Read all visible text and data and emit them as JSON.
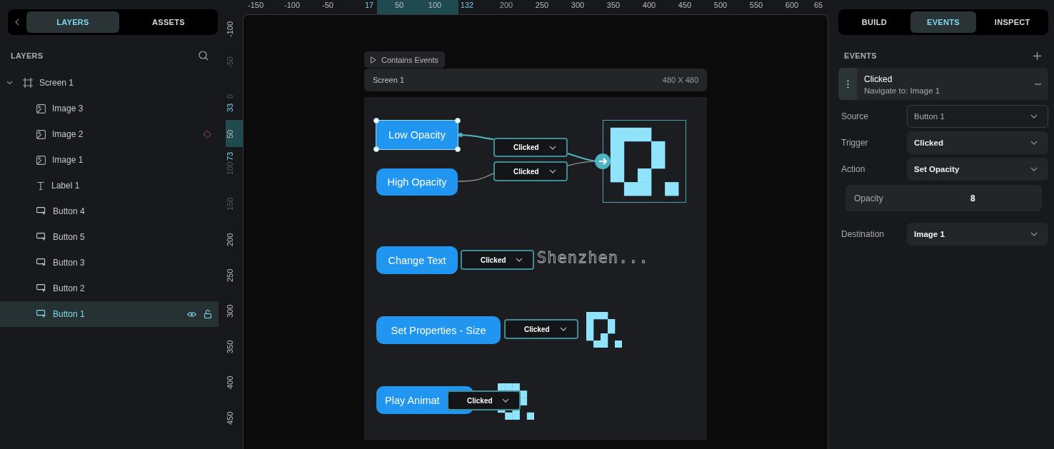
{
  "left_panel": {
    "tabs": [
      {
        "label": "LAYERS",
        "selected": true
      },
      {
        "label": "ASSETS",
        "selected": false
      }
    ],
    "section_title": "LAYERS",
    "layers": [
      {
        "name": "Screen 1",
        "kind": "screen",
        "expanded": true,
        "selected": false,
        "children": [
          {
            "name": "Image 3",
            "kind": "image",
            "selected": false,
            "flagged": false
          },
          {
            "name": "Image 2",
            "kind": "image",
            "selected": false,
            "flagged": true
          },
          {
            "name": "Image 1",
            "kind": "image",
            "selected": false,
            "flagged": false
          },
          {
            "name": "Label 1",
            "kind": "label",
            "selected": false,
            "flagged": false
          },
          {
            "name": "Button 4",
            "kind": "button",
            "selected": false,
            "flagged": false
          },
          {
            "name": "Button 5",
            "kind": "button",
            "selected": false,
            "flagged": false
          },
          {
            "name": "Button 3",
            "kind": "button",
            "selected": false,
            "flagged": false
          },
          {
            "name": "Button 2",
            "kind": "button",
            "selected": false,
            "flagged": false
          },
          {
            "name": "Button 1",
            "kind": "button",
            "selected": true,
            "flagged": false
          }
        ]
      }
    ]
  },
  "rulers": {
    "horizontal": [
      {
        "label": "-150",
        "kind": "tick"
      },
      {
        "label": "-100",
        "kind": "tick"
      },
      {
        "label": "-50",
        "kind": "tick"
      },
      {
        "label": "17",
        "kind": "marker"
      },
      {
        "label": "50",
        "kind": "tick"
      },
      {
        "label": "100",
        "kind": "tick"
      },
      {
        "label": "132",
        "kind": "marker"
      },
      {
        "label": "200",
        "kind": "dim"
      },
      {
        "label": "250",
        "kind": "tick"
      },
      {
        "label": "300",
        "kind": "tick"
      },
      {
        "label": "350",
        "kind": "tick"
      },
      {
        "label": "400",
        "kind": "tick"
      },
      {
        "label": "450",
        "kind": "tick"
      },
      {
        "label": "500",
        "kind": "tick"
      },
      {
        "label": "550",
        "kind": "tick"
      },
      {
        "label": "600",
        "kind": "tick"
      },
      {
        "label": "65",
        "kind": "tick"
      }
    ],
    "vertical": [
      {
        "label": "-100",
        "kind": "tick"
      },
      {
        "label": "-50",
        "kind": "dim"
      },
      {
        "label": "0",
        "kind": "dim"
      },
      {
        "label": "33",
        "kind": "marker"
      },
      {
        "label": "50",
        "kind": "tick"
      },
      {
        "label": "73",
        "kind": "marker"
      },
      {
        "label": "100",
        "kind": "dim"
      },
      {
        "label": "150",
        "kind": "dim"
      },
      {
        "label": "200",
        "kind": "tick"
      },
      {
        "label": "250",
        "kind": "tick"
      },
      {
        "label": "300",
        "kind": "tick"
      },
      {
        "label": "350",
        "kind": "tick"
      },
      {
        "label": "400",
        "kind": "tick"
      },
      {
        "label": "450",
        "kind": "tick"
      }
    ]
  },
  "canvas": {
    "badge": "Contains Events",
    "screen": {
      "title": "Screen 1",
      "size": "480 X 480"
    },
    "elements": [
      {
        "kind": "button",
        "label": "Low Opacity",
        "selected": true
      },
      {
        "kind": "trigger",
        "label": "Clicked"
      },
      {
        "kind": "trigger",
        "label": "Clicked"
      },
      {
        "kind": "button",
        "label": "High Opacity",
        "selected": false
      },
      {
        "kind": "image",
        "targeted": true
      },
      {
        "kind": "button",
        "label": "Change Text",
        "selected": false
      },
      {
        "kind": "trigger",
        "label": "Clicked"
      },
      {
        "kind": "text",
        "label": "Shenzhen..."
      },
      {
        "kind": "button",
        "label": "Set Properties - Size",
        "selected": false
      },
      {
        "kind": "trigger",
        "label": "Clicked"
      },
      {
        "kind": "image",
        "targeted": false
      },
      {
        "kind": "button",
        "label": "Play Animat",
        "selected": false
      },
      {
        "kind": "image",
        "targeted": false
      },
      {
        "kind": "trigger",
        "label": "Clicked"
      }
    ]
  },
  "right_panel": {
    "tabs": [
      {
        "label": "BUILD",
        "selected": false
      },
      {
        "label": "EVENTS",
        "selected": true
      },
      {
        "label": "INSPECT",
        "selected": false
      }
    ],
    "section_title": "EVENTS",
    "event": {
      "title": "Clicked",
      "subtitle": "Navigate to: Image 1"
    },
    "fields": [
      {
        "kind": "select",
        "label": "Source",
        "value": "Button 1",
        "disabled": true
      },
      {
        "kind": "select",
        "label": "Trigger",
        "value": "Clicked",
        "disabled": false
      },
      {
        "kind": "select",
        "label": "Action",
        "value": "Set Opacity",
        "disabled": false
      },
      {
        "kind": "number",
        "label": "Opacity",
        "value": "8"
      },
      {
        "kind": "select",
        "label": "Destination",
        "value": "Image 1",
        "disabled": false
      }
    ]
  }
}
